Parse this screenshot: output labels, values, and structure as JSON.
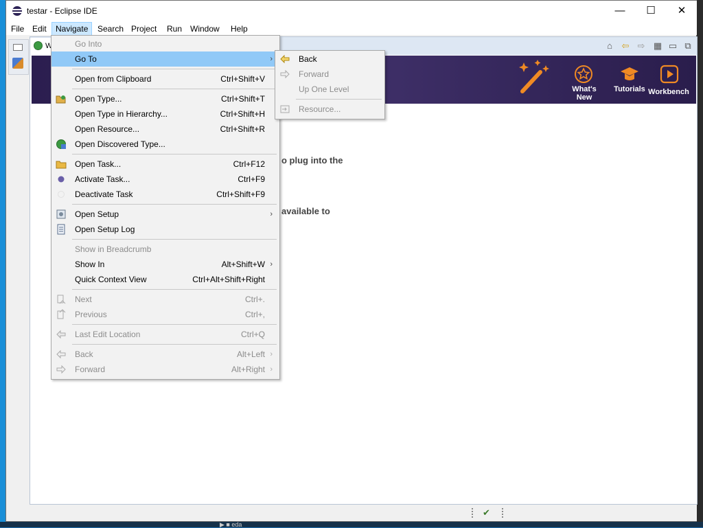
{
  "window": {
    "title": "testar - Eclipse IDE"
  },
  "window_controls": {
    "minimize": "—",
    "maximize": "☐",
    "close": "✕"
  },
  "menubar": [
    "File",
    "Edit",
    "Navigate",
    "Search",
    "Project",
    "Run",
    "Window",
    "Help"
  ],
  "editor_tab": {
    "label": "W"
  },
  "banner": {
    "whats_new": "What's New",
    "tutorials": "Tutorials",
    "workbench": "Workbench"
  },
  "body_text": [
    "o plug into the",
    "available to"
  ],
  "navigate_menu": {
    "items": [
      {
        "label": "Go Into",
        "shortcut": "",
        "disabled": true
      },
      {
        "label": "Go To",
        "shortcut": "",
        "submenu": true,
        "highlighted": true
      },
      {
        "label": "Open from Clipboard",
        "shortcut": "Ctrl+Shift+V"
      },
      {
        "label": "Open Type...",
        "shortcut": "Ctrl+Shift+T",
        "icon": "open-type-icon"
      },
      {
        "label": "Open Type in Hierarchy...",
        "shortcut": "Ctrl+Shift+H"
      },
      {
        "label": "Open Resource...",
        "shortcut": "Ctrl+Shift+R"
      },
      {
        "label": "Open Discovered Type...",
        "shortcut": "",
        "icon": "discovered-type-icon"
      },
      {
        "label": "Open Task...",
        "shortcut": "Ctrl+F12",
        "icon": "task-folder-icon"
      },
      {
        "label": "Activate Task...",
        "shortcut": "Ctrl+F9",
        "icon": "activate-task-icon"
      },
      {
        "label": "Deactivate Task",
        "shortcut": "Ctrl+Shift+F9"
      },
      {
        "label": "Open Setup",
        "shortcut": "",
        "submenu": true,
        "icon": "setup-icon"
      },
      {
        "label": "Open Setup Log",
        "shortcut": "",
        "icon": "setup-log-icon"
      },
      {
        "label": "Show in Breadcrumb",
        "shortcut": "",
        "disabled": true
      },
      {
        "label": "Show In",
        "shortcut": "Alt+Shift+W",
        "submenu": true
      },
      {
        "label": "Quick Context View",
        "shortcut": "Ctrl+Alt+Shift+Right"
      },
      {
        "label": "Next",
        "shortcut": "Ctrl+.",
        "disabled": true,
        "icon": "next-annotation-icon"
      },
      {
        "label": "Previous",
        "shortcut": "Ctrl+,",
        "disabled": true,
        "icon": "previous-annotation-icon"
      },
      {
        "label": "Last Edit Location",
        "shortcut": "Ctrl+Q",
        "disabled": true,
        "icon": "last-edit-icon"
      },
      {
        "label": "Back",
        "shortcut": "Alt+Left",
        "disabled": true,
        "submenu": true,
        "icon": "back-arrow-icon"
      },
      {
        "label": "Forward",
        "shortcut": "Alt+Right",
        "disabled": true,
        "submenu": true,
        "icon": "forward-arrow-icon"
      }
    ]
  },
  "goto_submenu": {
    "items": [
      {
        "label": "Back",
        "disabled": false,
        "icon": "back-arrow-icon"
      },
      {
        "label": "Forward",
        "disabled": true,
        "icon": "forward-arrow-icon"
      },
      {
        "label": "Up One Level",
        "disabled": true
      },
      {
        "label": "Resource...",
        "disabled": true,
        "icon": "resource-icon"
      }
    ]
  },
  "taskbar": {
    "label": "eda"
  },
  "colors": {
    "menu_highlight": "#91c9f7",
    "banner": "#3d2e66",
    "banner_accent": "#f08a24"
  }
}
